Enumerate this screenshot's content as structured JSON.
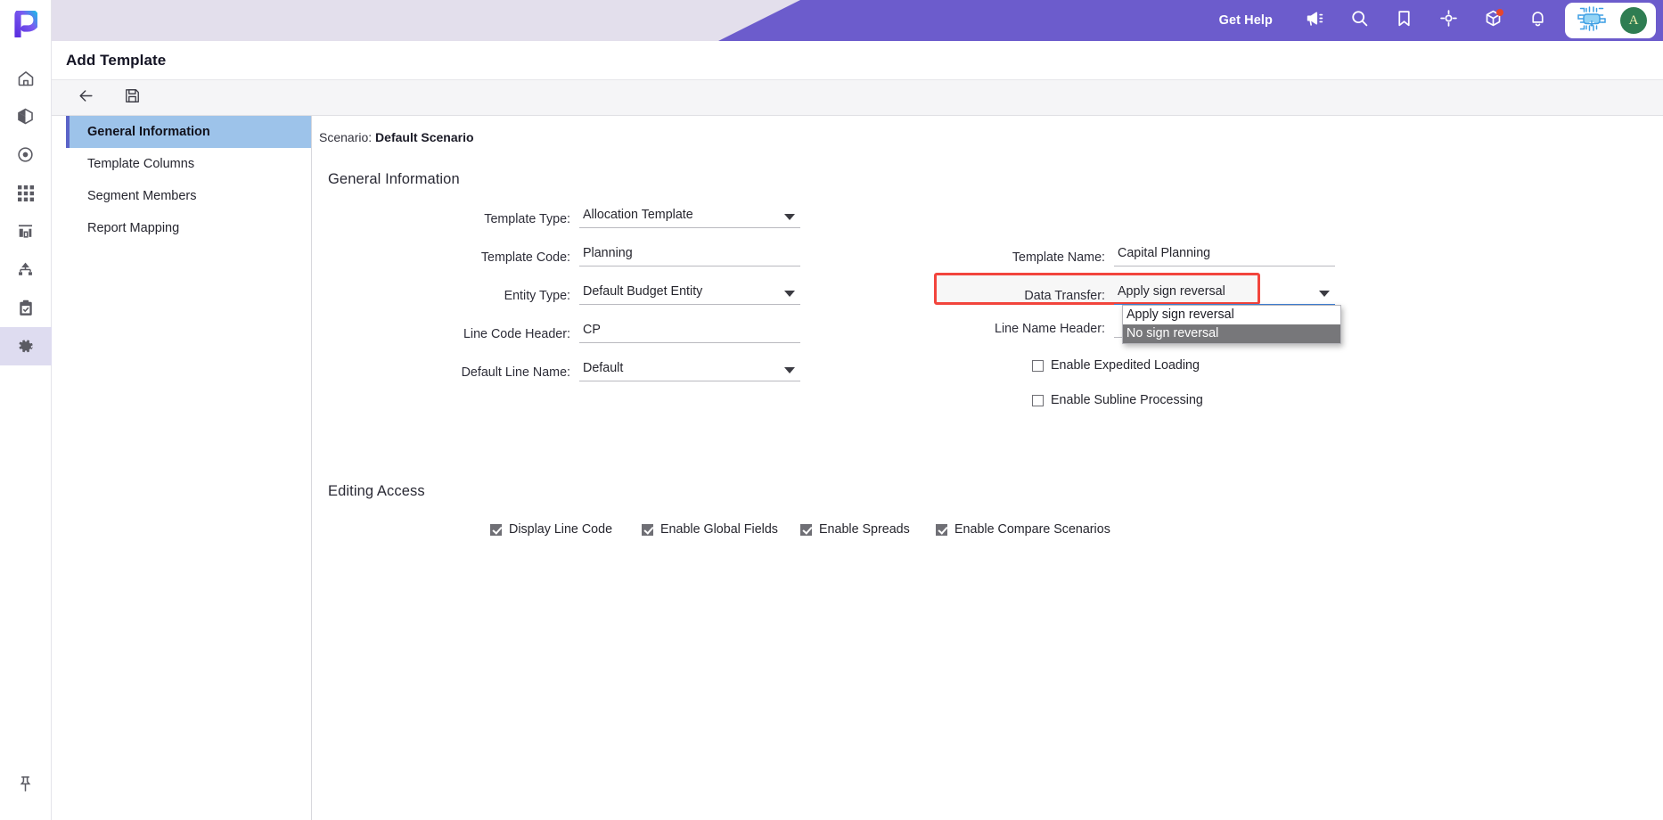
{
  "app": {
    "logo_icon": "planful-p-logo",
    "page_title": "Add Template"
  },
  "rail": {
    "items": [
      {
        "name": "home",
        "icon": "home-icon"
      },
      {
        "name": "modeling",
        "icon": "cube-icon"
      },
      {
        "name": "target",
        "icon": "target-icon"
      },
      {
        "name": "grid",
        "icon": "grid-icon"
      },
      {
        "name": "reports",
        "icon": "bar-chart-icon"
      },
      {
        "name": "hierarchy",
        "icon": "hierarchy-icon"
      },
      {
        "name": "tasks",
        "icon": "clipboard-check-icon"
      },
      {
        "name": "configuration",
        "icon": "gear-icon",
        "active": true
      }
    ],
    "pin_icon": "pushpin-icon"
  },
  "topbar": {
    "get_help_label": "Get Help",
    "icons": [
      {
        "name": "announcements",
        "icon": "megaphone-icon"
      },
      {
        "name": "search",
        "icon": "search-icon"
      },
      {
        "name": "bookmarks",
        "icon": "bookmark-icon"
      },
      {
        "name": "navigate",
        "icon": "crosshair-icon"
      },
      {
        "name": "packages",
        "icon": "cube-badge-icon",
        "badge": true
      },
      {
        "name": "notifications",
        "icon": "bell-icon"
      }
    ],
    "ai_assistant_icon": "ai-chip-icon",
    "avatar_initial": "A",
    "accent_purple": "#6c5ccc",
    "avatar_color": "#2f7d52",
    "badge_color": "#e8452c"
  },
  "toolbar": {
    "back_label": "Back",
    "back_icon": "arrow-left-icon",
    "save_label": "Save",
    "save_icon": "floppy-disk-icon"
  },
  "leftnav": {
    "items": [
      {
        "label": "General Information",
        "active": true
      },
      {
        "label": "Template Columns",
        "active": false
      },
      {
        "label": "Segment Members",
        "active": false
      },
      {
        "label": "Report Mapping",
        "active": false
      }
    ],
    "active_bg": "#9dc3ea",
    "active_border": "#5b64c8"
  },
  "pane": {
    "scenario_label": "Scenario:",
    "scenario_value": "Default Scenario",
    "general_section_title": "General Information",
    "editing_section_title": "Editing Access",
    "fields_left": [
      {
        "label": "Template Type:",
        "value": "Allocation Template",
        "type": "select"
      },
      {
        "label": "Template Code:",
        "value": "Planning",
        "type": "text"
      },
      {
        "label": "Entity Type:",
        "value": "Default Budget Entity",
        "type": "select"
      },
      {
        "label": "Line Code Header:",
        "value": "CP",
        "type": "text"
      },
      {
        "label": "Default Line Name:",
        "value": "Default",
        "type": "select"
      }
    ],
    "fields_right": [
      {
        "label": "Template Name:",
        "value": "Capital Planning",
        "type": "text"
      },
      {
        "label": "Data Transfer:",
        "value": "Apply sign reversal",
        "type": "select",
        "highlighted": true
      },
      {
        "label": "Line Name Header:",
        "value": "",
        "type": "text"
      }
    ],
    "data_transfer_options": [
      {
        "label": "Apply sign reversal",
        "highlighted": false
      },
      {
        "label": "No sign reversal",
        "highlighted": true
      }
    ],
    "right_checkboxes": [
      {
        "label": "Enable Expedited Loading",
        "checked": false
      },
      {
        "label": "Enable Subline Processing",
        "checked": false
      }
    ],
    "editing_access_checkboxes": [
      {
        "label": "Display Line Code",
        "checked": true
      },
      {
        "label": "Enable Global Fields",
        "checked": true
      },
      {
        "label": "Enable Spreads",
        "checked": true
      },
      {
        "label": "Enable Compare Scenarios",
        "checked": true
      }
    ],
    "highlight_color": "#f2453d"
  }
}
